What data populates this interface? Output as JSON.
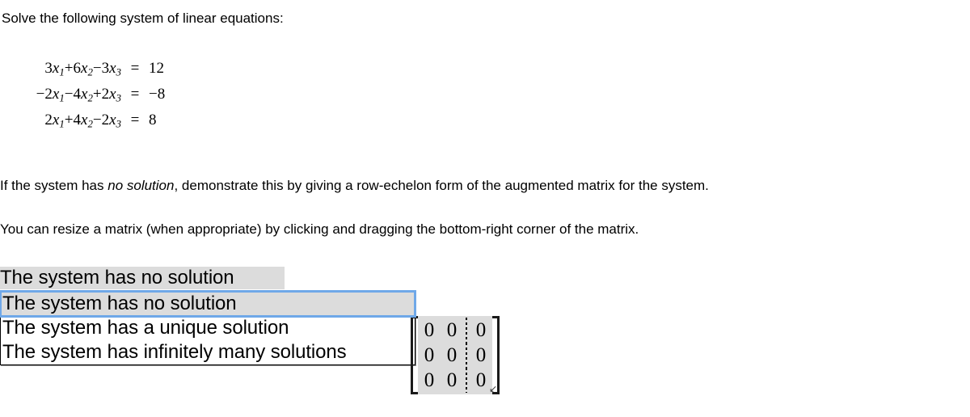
{
  "prompt": {
    "title": "Solve the following system of linear equations:",
    "demo_prefix": "If the system has ",
    "demo_emphasis": "no solution",
    "demo_suffix": ", demonstrate this by giving a row-echelon form of the augmented matrix for the system.",
    "resize_hint": "You can resize a matrix (when appropriate) by clicking and dragging the bottom-right corner of the matrix."
  },
  "system": {
    "equations": [
      {
        "terms": [
          {
            "coef": "3",
            "var": "x",
            "sub": "1",
            "op": ""
          },
          {
            "coef": "6",
            "var": "x",
            "sub": "2",
            "op": "+"
          },
          {
            "coef": "3",
            "var": "x",
            "sub": "3",
            "op": "−"
          }
        ],
        "equals": "=",
        "rhs": "12"
      },
      {
        "terms": [
          {
            "coef": "2",
            "var": "x",
            "sub": "1",
            "op": "−"
          },
          {
            "coef": "4",
            "var": "x",
            "sub": "2",
            "op": "−"
          },
          {
            "coef": "2",
            "var": "x",
            "sub": "3",
            "op": "+"
          }
        ],
        "equals": "=",
        "rhs": "−8"
      },
      {
        "terms": [
          {
            "coef": "2",
            "var": "x",
            "sub": "1",
            "op": ""
          },
          {
            "coef": "4",
            "var": "x",
            "sub": "2",
            "op": "+"
          },
          {
            "coef": "2",
            "var": "x",
            "sub": "3",
            "op": "−"
          }
        ],
        "equals": "=",
        "rhs": "8"
      }
    ],
    "plain": [
      "3x1+6x2-3x3 = 12",
      "-2x1-4x2+2x3 = -8",
      "2x1+4x2-2x3 = 8"
    ]
  },
  "solution_select": {
    "selected_value": "The system has no solution",
    "expanded": true,
    "options": [
      "The system has no solution",
      "The system has a unique solution",
      "The system has infinitely many solutions"
    ],
    "selected_index": 0
  },
  "matrix": {
    "rows": 3,
    "columns": 3,
    "augmented_after_column": 2,
    "separator": "dotted",
    "values": [
      [
        "0",
        "0",
        "0"
      ],
      [
        "0",
        "0",
        "0"
      ],
      [
        "0",
        "0",
        "0"
      ]
    ],
    "resize_handle_glyph": "↙",
    "background_color": "#dcdcdc"
  },
  "colors": {
    "page_background": "#ffffff",
    "text": "#000000",
    "field_background": "#dcdcdc",
    "focus_ring": "#6fa8e8",
    "dropdown_background": "#ffffff",
    "border": "#000000"
  }
}
